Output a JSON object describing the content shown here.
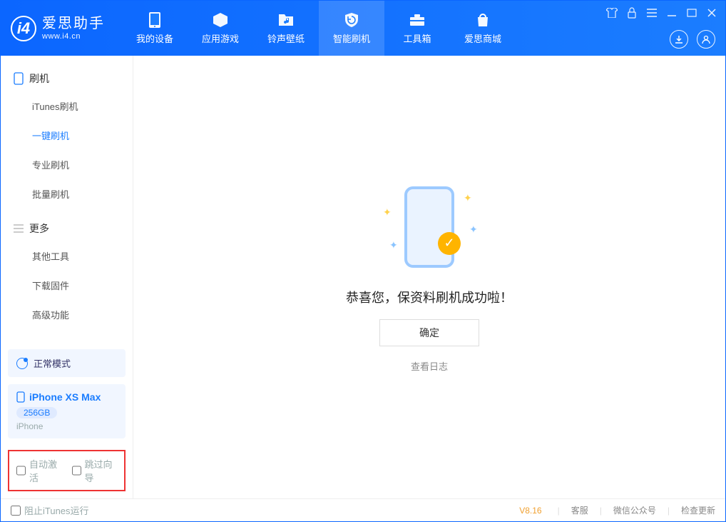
{
  "header": {
    "app_title": "爱思助手",
    "app_subtitle": "www.i4.cn",
    "nav": [
      "我的设备",
      "应用游戏",
      "铃声壁纸",
      "智能刷机",
      "工具箱",
      "爱思商城"
    ]
  },
  "sidebar": {
    "groups": [
      {
        "title": "刷机",
        "items": [
          "iTunes刷机",
          "一键刷机",
          "专业刷机",
          "批量刷机"
        ]
      },
      {
        "title": "更多",
        "items": [
          "其他工具",
          "下载固件",
          "高级功能"
        ]
      }
    ],
    "mode": "正常模式",
    "device": {
      "name": "iPhone XS Max",
      "capacity": "256GB",
      "type": "iPhone"
    },
    "options": [
      "自动激活",
      "跳过向导"
    ]
  },
  "main": {
    "message": "恭喜您，保资料刷机成功啦！",
    "ok_label": "确定",
    "log_link": "查看日志"
  },
  "statusbar": {
    "block_itunes": "阻止iTunes运行",
    "version": "V8.16",
    "links": [
      "客服",
      "微信公众号",
      "检查更新"
    ]
  }
}
